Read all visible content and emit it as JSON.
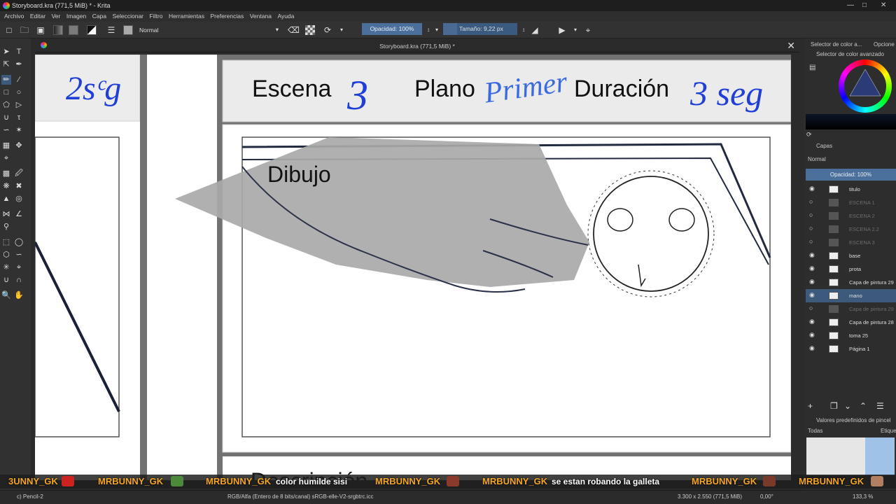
{
  "window": {
    "title": "Storyboard.kra (771,5 MiB) * - Krita"
  },
  "menu": [
    "Archivo",
    "Editar",
    "Ver",
    "Imagen",
    "Capa",
    "Seleccionar",
    "Filtro",
    "Herramientas",
    "Preferencias",
    "Ventana",
    "Ayuda"
  ],
  "toolbar": {
    "blend_mode": "Normal",
    "opacity": "Opacidad: 100%",
    "size": "Tamaño: 9,22 px"
  },
  "document": {
    "tab_title": "Storyboard.kra (771,5 MiB) *"
  },
  "canvas": {
    "left_panel_text": "2sᶜg",
    "scene_label": "Escena",
    "scene_number": "3",
    "plano_label": "Plano",
    "plano_value": "Primer",
    "duration_label": "Duración",
    "duration_value": "3 seg",
    "drawing_label": "Dibujo",
    "description_label": "Descripción"
  },
  "right_dock": {
    "color_tab": "Selector de color a...",
    "options_tab": "Opcione",
    "advanced_color": "Selector de color avanzado",
    "layers_title": "Capas",
    "layers_blend": "Normal",
    "layers_opacity": "Opacidad:  100%",
    "layers": [
      {
        "name": "titulo",
        "visible": true,
        "dim": false,
        "selected": false
      },
      {
        "name": "ESCENA 1",
        "visible": false,
        "dim": true,
        "selected": false
      },
      {
        "name": "ESCENA 2",
        "visible": false,
        "dim": true,
        "selected": false
      },
      {
        "name": "ESCENA 2.2",
        "visible": false,
        "dim": true,
        "selected": false
      },
      {
        "name": "ESCENA 3",
        "visible": false,
        "dim": true,
        "selected": false
      },
      {
        "name": "base",
        "visible": true,
        "dim": false,
        "selected": false
      },
      {
        "name": "prota",
        "visible": true,
        "dim": false,
        "selected": false
      },
      {
        "name": "Capa de pintura 29",
        "visible": true,
        "dim": false,
        "selected": false
      },
      {
        "name": "mano",
        "visible": true,
        "dim": false,
        "selected": true
      },
      {
        "name": "Capa de pintura 29",
        "visible": false,
        "dim": true,
        "selected": false
      },
      {
        "name": "Capa de pintura 28",
        "visible": true,
        "dim": false,
        "selected": false
      },
      {
        "name": "toma 25",
        "visible": true,
        "dim": false,
        "selected": false
      },
      {
        "name": "Página 1",
        "visible": true,
        "dim": false,
        "selected": false
      }
    ],
    "presets_title": "Valores predefinidos de pincel",
    "presets_filter": "Todas",
    "presets_tag": "Etique"
  },
  "status": {
    "tool": "c) Pencil-2",
    "colorspace": "RGB/Alfa (Entero de 8 bits/canal)  sRGB-elle-V2-srgbtrc.icc",
    "dimensions": "3.300 x 2.550 (771,5 MiB)",
    "rotation": "0,00°",
    "zoom": "133,3 %"
  },
  "chat": [
    {
      "name": "3UNNY_GK",
      "msg": ""
    },
    {
      "name": "MRBUNNY_GK",
      "msg": ""
    },
    {
      "name": "MRBUNNY_GK",
      "msg": "color humilde sisi"
    },
    {
      "name": "MRBUNNY_GK",
      "msg": ""
    },
    {
      "name": "MRBUNNY_GK",
      "msg": "se estan robando la galleta"
    },
    {
      "name": "MRBUNNY_GK",
      "msg": ""
    },
    {
      "name": "MRBUNNY_GK",
      "msg": ""
    }
  ],
  "colors": {
    "accent": "#4a6f9a",
    "chat_name": "#f5a623",
    "ink_blue": "#1f3fd6"
  }
}
